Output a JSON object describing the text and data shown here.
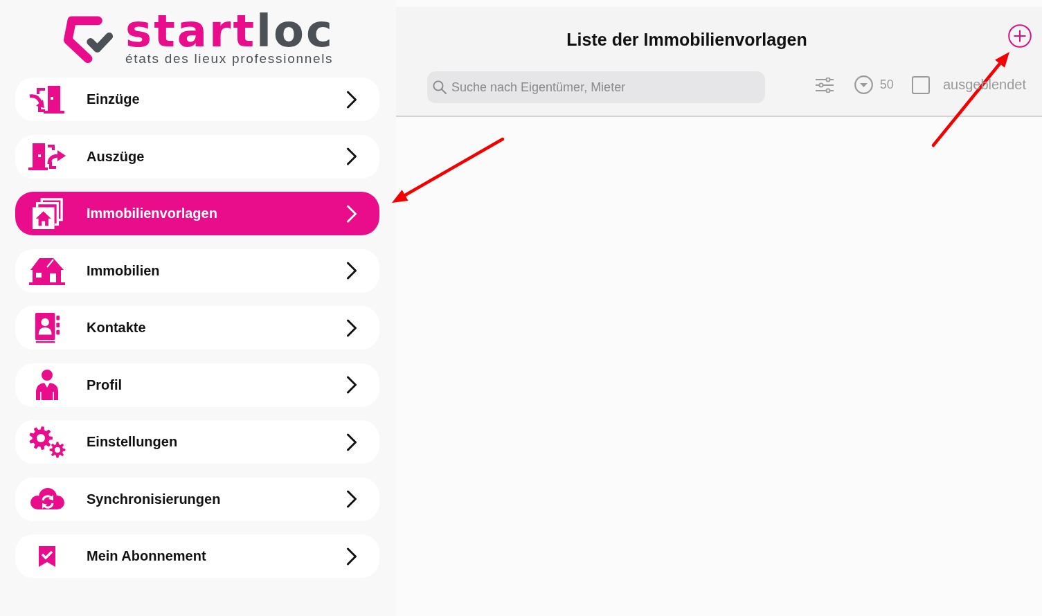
{
  "logo": {
    "wordmark_parts": [
      "start",
      "loc"
    ],
    "tagline": "états des lieux professionnels"
  },
  "sidebar": {
    "items": [
      {
        "label": "Einzüge",
        "selected": false
      },
      {
        "label": "Auszüge",
        "selected": false
      },
      {
        "label": "Immobilienvorlagen",
        "selected": true
      },
      {
        "label": "Immobilien",
        "selected": false
      },
      {
        "label": "Kontakte",
        "selected": false
      },
      {
        "label": "Profil",
        "selected": false
      },
      {
        "label": "Einstellungen",
        "selected": false
      },
      {
        "label": "Synchronisierungen",
        "selected": false
      },
      {
        "label": "Mein Abonnement",
        "selected": false
      }
    ]
  },
  "header": {
    "title": "Liste der Immobilienvorlagen",
    "search": {
      "placeholder": "Suche nach Eigentümer, Mieter"
    },
    "page_size": "50",
    "hidden_filter": {
      "label": "ausgeblendet",
      "checked": false
    }
  }
}
